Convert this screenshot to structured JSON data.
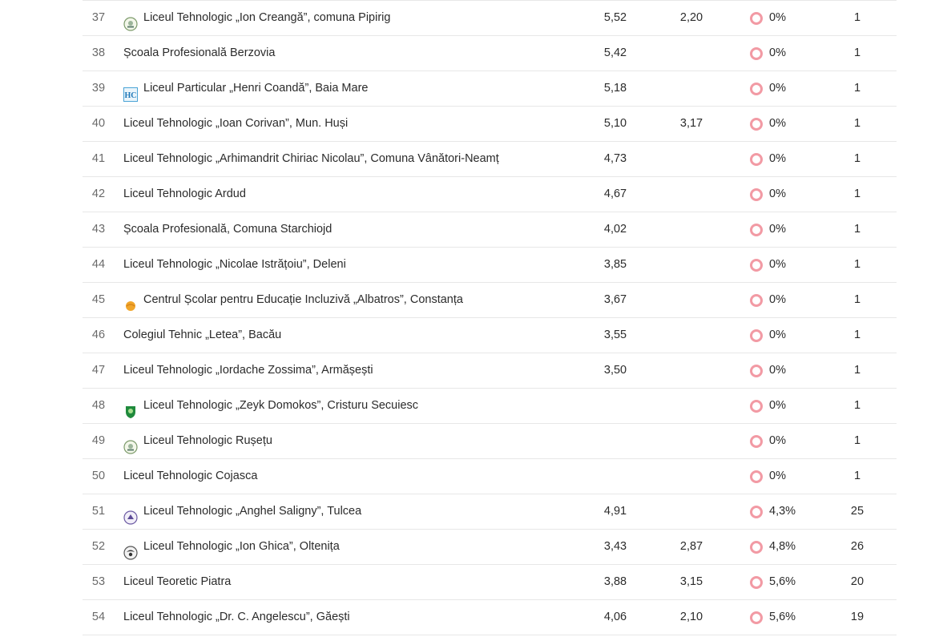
{
  "colors": {
    "divider": "#e7e7e7",
    "status_dot": "#f29aa4",
    "rank_text": "#6a6a6a"
  },
  "rows": [
    {
      "rank": "37",
      "name": "Liceul Tehnologic „Ion Creangă”, comuna Pipirig",
      "logo": "school-crest-icon",
      "avg1": "5,52",
      "avg2": "2,20",
      "pct": "0%",
      "count": "1"
    },
    {
      "rank": "38",
      "name": "Școala Profesională Berzovia",
      "logo": "",
      "avg1": "5,42",
      "avg2": "",
      "pct": "0%",
      "count": "1"
    },
    {
      "rank": "39",
      "name": "Liceul Particular „Henri Coandă”, Baia Mare",
      "logo": "hc-logo-icon",
      "avg1": "5,18",
      "avg2": "",
      "pct": "0%",
      "count": "1"
    },
    {
      "rank": "40",
      "name": "Liceul Tehnologic „Ioan Corivan”, Mun. Huși",
      "logo": "",
      "avg1": "5,10",
      "avg2": "3,17",
      "pct": "0%",
      "count": "1"
    },
    {
      "rank": "41",
      "name": "Liceul Tehnologic „Arhimandrit Chiriac Nicolau”, Comuna Vânători-Neamț",
      "logo": "",
      "avg1": "4,73",
      "avg2": "",
      "pct": "0%",
      "count": "1"
    },
    {
      "rank": "42",
      "name": "Liceul Tehnologic Ardud",
      "logo": "",
      "avg1": "4,67",
      "avg2": "",
      "pct": "0%",
      "count": "1"
    },
    {
      "rank": "43",
      "name": "Școala Profesională, Comuna Starchiojd",
      "logo": "",
      "avg1": "4,02",
      "avg2": "",
      "pct": "0%",
      "count": "1"
    },
    {
      "rank": "44",
      "name": "Liceul Tehnologic „Nicolae Istrățoiu”, Deleni",
      "logo": "",
      "avg1": "3,85",
      "avg2": "",
      "pct": "0%",
      "count": "1"
    },
    {
      "rank": "45",
      "name": "Centrul Școlar pentru Educație Incluzivă „Albatros”, Constanța",
      "logo": "albatros-logo-icon",
      "avg1": "3,67",
      "avg2": "",
      "pct": "0%",
      "count": "1"
    },
    {
      "rank": "46",
      "name": "Colegiul Tehnic „Letea”, Bacău",
      "logo": "",
      "avg1": "3,55",
      "avg2": "",
      "pct": "0%",
      "count": "1"
    },
    {
      "rank": "47",
      "name": "Liceul Tehnologic „Iordache Zossima”, Armășești",
      "logo": "",
      "avg1": "3,50",
      "avg2": "",
      "pct": "0%",
      "count": "1"
    },
    {
      "rank": "48",
      "name": "Liceul Tehnologic „Zeyk Domokos”, Cristuru Secuiesc",
      "logo": "green-shield-icon",
      "avg1": "",
      "avg2": "",
      "pct": "0%",
      "count": "1"
    },
    {
      "rank": "49",
      "name": "Liceul Tehnologic Rușețu",
      "logo": "school-crest-icon",
      "avg1": "",
      "avg2": "",
      "pct": "0%",
      "count": "1"
    },
    {
      "rank": "50",
      "name": "Liceul Tehnologic Cojasca",
      "logo": "",
      "avg1": "",
      "avg2": "",
      "pct": "0%",
      "count": "1"
    },
    {
      "rank": "51",
      "name": "Liceul Tehnologic „Anghel Saligny”, Tulcea",
      "logo": "purple-crest-icon",
      "avg1": "4,91",
      "avg2": "",
      "pct": "4,3%",
      "count": "25"
    },
    {
      "rank": "52",
      "name": "Liceul Tehnologic „Ion Ghica”, Oltenița",
      "logo": "eagle-crest-icon",
      "avg1": "3,43",
      "avg2": "2,87",
      "pct": "4,8%",
      "count": "26"
    },
    {
      "rank": "53",
      "name": "Liceul Teoretic Piatra",
      "logo": "",
      "avg1": "3,88",
      "avg2": "3,15",
      "pct": "5,6%",
      "count": "20"
    },
    {
      "rank": "54",
      "name": "Liceul Tehnologic „Dr. C. Angelescu”, Găești",
      "logo": "",
      "avg1": "4,06",
      "avg2": "2,10",
      "pct": "5,6%",
      "count": "19"
    }
  ]
}
